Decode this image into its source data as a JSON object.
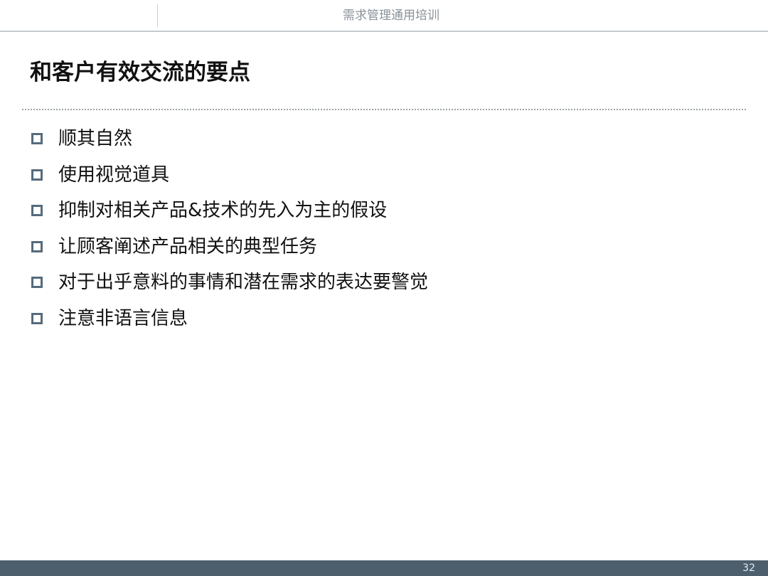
{
  "header": {
    "deck_title": "需求管理通用培训"
  },
  "slide": {
    "title": "和客户有效交流的要点",
    "bullets": [
      "顺其自然",
      "使用视觉道具",
      "抑制对相关产品&技术的先入为主的假设",
      "让顾客阐述产品相关的典型任务",
      "对于出乎意料的事情和潜在需求的表达要警觉",
      "注意非语言信息"
    ]
  },
  "footer": {
    "page_number": "32"
  },
  "colors": {
    "footer_bar": "#4d5e6c",
    "bullet_marker": "#566b7c",
    "header_text": "#8a9299"
  },
  "icons": {
    "bullet": "hollow-square-bullet-icon"
  }
}
